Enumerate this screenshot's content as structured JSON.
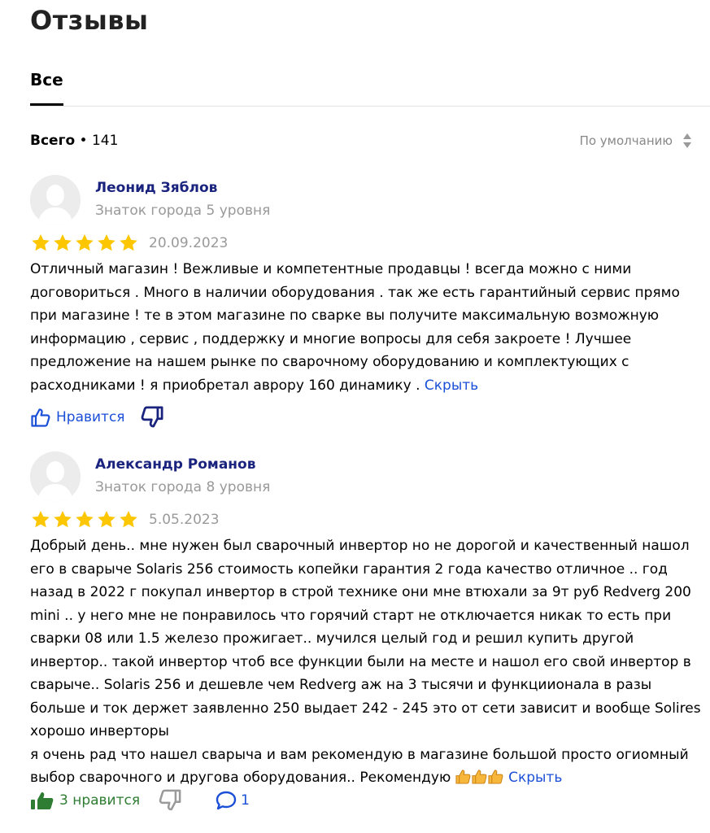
{
  "page": {
    "title": "Отзывы",
    "tab_all": "Все",
    "total_label": "Всего",
    "total_sep": " • ",
    "total_count": "141",
    "sort_label": "По умолчанию"
  },
  "reviews": [
    {
      "author": "Леонид Зяблов",
      "level": "Знаток города 5 уровня",
      "rating": 5,
      "date": "20.09.2023",
      "text": "Отличный магазин ! Вежливые и компетентные продавцы ! всегда можно с ними договориться . Много в наличии оборудования . так же есть гарантийный сервис прямо при магазине ! те в этом магазине по сварке вы получите максимальную возможную информацию , сервис , поддержку и многие вопросы для себя закроете ! Лучшее предложение на нашем рынке по сварочному оборудованию и комплектующих с расходниками ! я приобретал аврору 160 динамику .",
      "hide_label": "Скрыть",
      "like_label": "Нравится"
    },
    {
      "author": "Александр Романов",
      "level": "Знаток города 8 уровня",
      "rating": 5,
      "date": "5.05.2023",
      "text_line1": "Добрый день.. мне нужен был сварочный инвертор но не дорогой и качественный нашол его в сварыче Solaris 256 стоимость копейки гарантия 2 года качество отличное .. год назад в 2022 г покупал инвертор в строй технике они мне втюхали за 9т руб Redverg 200 mini .. у него мне не понравилось что горячий старт не отключается никак то есть при сварки 08 или 1.5 железо прожигает.. мучился целый год и решил купить другой инвертор.. такой инвертор чтоб все функции были на месте и нашол его свой инвертор в сварыче.. Solaris 256 и дешевле чем Redverg аж на 3 тысячи и функциионала в разы больше и ток держет заявленно 250 выдает 242 - 245 это от сети зависит и вообще Solires хорошо инверторы",
      "text_line2": "я очень рад что нашел сварыча и вам рекомендую в магазине большой просто огиомный выбор сварочного и другова оборудования.. Рекомендую",
      "hide_label": "Скрыть",
      "like_label": "3 нравится",
      "comment_count": "1"
    }
  ],
  "colors": {
    "star": "#FCC600",
    "link": "#1B4FD8",
    "author": "#1A237E",
    "like_active": "#2E7D32",
    "muted": "#999999"
  },
  "icons": [
    "star-icon",
    "like-icon",
    "dislike-icon",
    "comment-icon",
    "sort-arrows-icon",
    "thumbs-up-emoji",
    "avatar-placeholder-icon"
  ]
}
